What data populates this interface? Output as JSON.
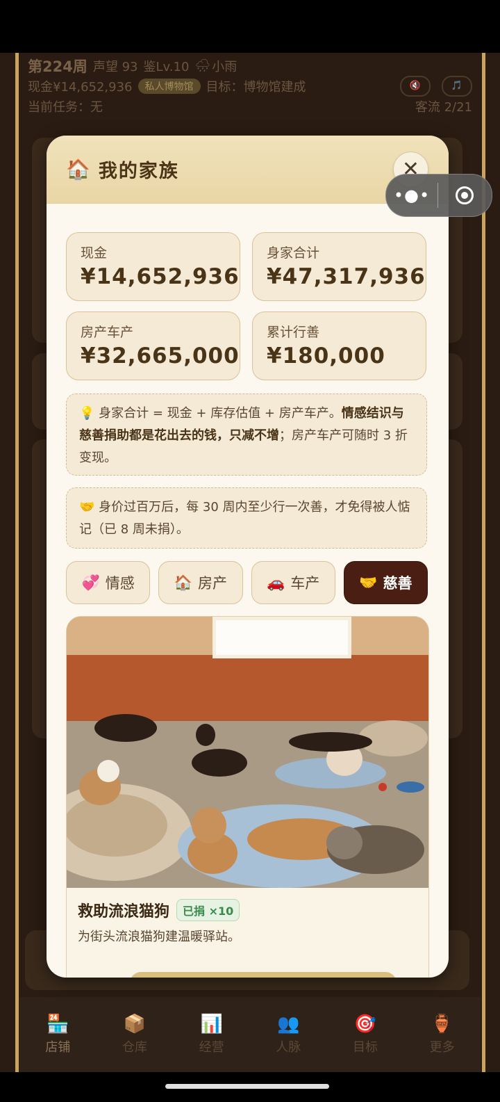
{
  "hud": {
    "week": "第224周",
    "reputation": "声望 93",
    "appraisal": "鉴Lv.10",
    "weather_icon": "🌧",
    "weather": "小雨",
    "cash": "现金¥14,652,936",
    "museum_badge": "私人博物馆",
    "goal": "目标：博物馆建成",
    "mute_icon": "🔇",
    "music_icon": "🎵",
    "task": "当前任务：无",
    "traffic": "客流 2/21"
  },
  "modal": {
    "title_icon": "🏠",
    "title": "我的家族",
    "close": "✕",
    "stats": [
      {
        "label": "现金",
        "value": "¥14,652,936"
      },
      {
        "label": "身家合计",
        "value": "¥47,317,936"
      },
      {
        "label": "房产车产",
        "value": "¥32,665,000"
      },
      {
        "label": "累计行善",
        "value": "¥180,000"
      }
    ],
    "note1": {
      "icon": "💡",
      "text_a": " 身家合计 = 现金 + 库存估值 + 房产车产。",
      "text_b": "情感结识与慈善捐助都是花出去的钱，只减不增",
      "text_c": "；房产车产可随时 3 折变现。"
    },
    "note2": {
      "icon": "🤝",
      "text": " 身价过百万后，每 30 周内至少行一次善，才免得被人惦记（已 8 周未捐）。"
    },
    "tabs": [
      {
        "icon": "💞",
        "label": "情感"
      },
      {
        "icon": "🏠",
        "label": "房产"
      },
      {
        "icon": "🚗",
        "label": "车产"
      },
      {
        "icon": "🤝",
        "label": "慈善"
      }
    ],
    "card": {
      "title": "救助流浪猫狗",
      "badge": "已捐 ×10",
      "desc": "为街头流浪猫狗建温暖驿站。"
    }
  },
  "nav": [
    {
      "icon": "🏪",
      "label": "店铺"
    },
    {
      "icon": "📦",
      "label": "仓库"
    },
    {
      "icon": "📊",
      "label": "经营"
    },
    {
      "icon": "👥",
      "label": "人脉"
    },
    {
      "icon": "🎯",
      "label": "目标"
    },
    {
      "icon": "🏺",
      "label": "更多"
    }
  ],
  "capsule": {
    "dots": "•●•"
  }
}
